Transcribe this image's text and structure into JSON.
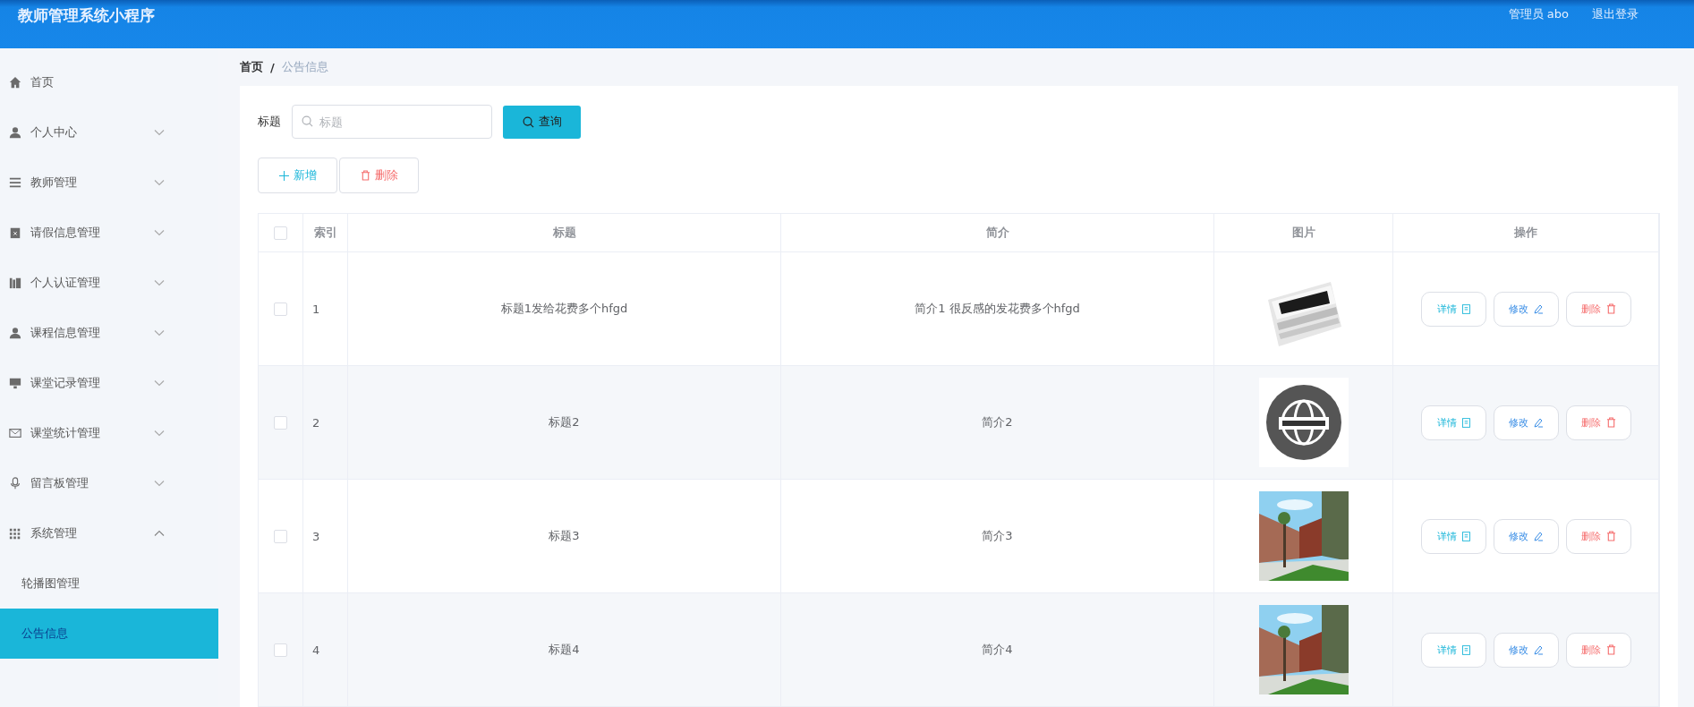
{
  "header": {
    "title": "教师管理系统小程序",
    "user": "管理员 abo",
    "logout": "退出登录"
  },
  "sidebar": {
    "items": [
      {
        "label": "首页",
        "selected": false
      },
      {
        "label": "个人中心",
        "expanded": false,
        "selected": false
      },
      {
        "label": "教师管理",
        "expanded": false,
        "selected": false
      },
      {
        "label": "请假信息管理",
        "expanded": false,
        "selected": false
      },
      {
        "label": "个人认证管理",
        "expanded": false,
        "selected": false
      },
      {
        "label": "课程信息管理",
        "expanded": false,
        "selected": false
      },
      {
        "label": "课堂记录管理",
        "expanded": false,
        "selected": false
      },
      {
        "label": "课堂统计管理",
        "expanded": false,
        "selected": false
      },
      {
        "label": "留言板管理",
        "expanded": false,
        "selected": false
      },
      {
        "label": "系统管理",
        "expanded": true,
        "selected": false,
        "children": [
          {
            "label": "轮播图管理",
            "selected": false
          },
          {
            "label": "公告信息",
            "selected": true
          }
        ]
      }
    ]
  },
  "breadcrumb": {
    "separator": "/",
    "items": [
      "首页",
      "公告信息"
    ]
  },
  "search": {
    "label": "标题",
    "placeholder": "标题",
    "button": "查询"
  },
  "toolbar": [
    {
      "kind": "add",
      "label": "新增"
    },
    {
      "kind": "delete",
      "label": "删除"
    }
  ],
  "table": {
    "columns": [
      "索引",
      "标题",
      "简介",
      "图片",
      "操作"
    ],
    "all_checked": false,
    "rows": [
      {
        "checked": false,
        "index": "1",
        "title": "标题1发给花费多个hfgd",
        "intro": "简介1 很反感的发花费多个hfgd",
        "image": {
          "kind": "picture"
        },
        "actions": [
          {
            "kind": "detail",
            "label": "详情"
          },
          {
            "kind": "edit",
            "label": "修改"
          },
          {
            "kind": "delete",
            "label": "删除"
          }
        ]
      },
      {
        "checked": false,
        "index": "2",
        "title": "标题2",
        "intro": "简介2",
        "image": {
          "kind": "picture"
        },
        "actions": [
          {
            "kind": "detail",
            "label": "详情"
          },
          {
            "kind": "edit",
            "label": "修改"
          },
          {
            "kind": "delete",
            "label": "删除"
          }
        ]
      },
      {
        "checked": false,
        "index": "3",
        "title": "标题3",
        "intro": "简介3",
        "image": {
          "kind": "picture"
        },
        "actions": [
          {
            "kind": "detail",
            "label": "详情"
          },
          {
            "kind": "edit",
            "label": "修改"
          },
          {
            "kind": "delete",
            "label": "删除"
          }
        ]
      },
      {
        "checked": false,
        "index": "4",
        "title": "标题4",
        "intro": "简介4",
        "image": {
          "kind": "picture"
        },
        "actions": [
          {
            "kind": "detail",
            "label": "详情"
          },
          {
            "kind": "edit",
            "label": "修改"
          },
          {
            "kind": "delete",
            "label": "删除"
          }
        ]
      }
    ]
  }
}
